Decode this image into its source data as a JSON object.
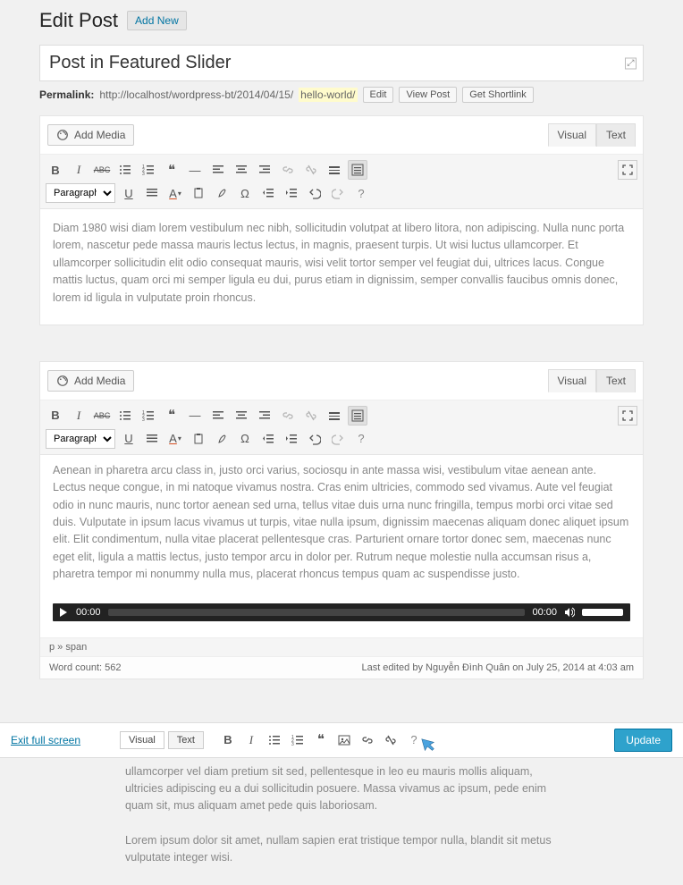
{
  "header": {
    "title": "Edit Post",
    "add_new": "Add New"
  },
  "post": {
    "title": "Post in Featured Slider"
  },
  "permalink": {
    "label": "Permalink:",
    "url_prefix": "http://localhost/wordpress-bt/2014/04/15/",
    "slug": "hello-world/",
    "edit": "Edit",
    "view_post": "View Post",
    "get_shortlink": "Get Shortlink"
  },
  "editor": {
    "add_media": "Add Media",
    "tabs": {
      "visual": "Visual",
      "text": "Text"
    },
    "paragraph": "Paragraph",
    "content1": "Diam 1980 wisi diam lorem vestibulum nec nibh, sollicitudin volutpat at libero litora, non adipiscing. Nulla nunc porta lorem, nascetur pede massa mauris lectus lectus, in magnis, praesent turpis. Ut wisi luctus ullamcorper. Et ullamcorper sollicitudin elit odio consequat mauris, wisi velit tortor semper vel feugiat dui, ultrices lacus. Congue mattis luctus, quam orci mi semper ligula eu dui, purus etiam in dignissim, semper convallis faucibus omnis donec, lorem id ligula in vulputate proin rhoncus."
  },
  "editor2": {
    "add_media": "Add Media",
    "tabs": {
      "visual": "Visual",
      "text": "Text"
    },
    "paragraph": "Paragraph",
    "content": "Aenean in pharetra arcu class in, justo orci varius, sociosqu in ante massa wisi, vestibulum vitae aenean ante. Lectus neque congue, in mi natoque vivamus nostra. Cras enim ultricies, commodo sed vivamus. Aute vel feugiat odio in nunc mauris, nunc tortor aenean sed urna, tellus vitae duis urna nunc fringilla, tempus morbi orci vitae sed duis. Vulputate in ipsum lacus vivamus ut turpis, vitae nulla ipsum, dignissim maecenas aliquam donec aliquet ipsum elit. Elit condimentum, nulla vitae placerat pellentesque cras. Parturient ornare tortor donec sem, maecenas nunc eget elit, ligula a mattis lectus, justo tempor arcu in dolor per. Rutrum neque molestie nulla accumsan risus a, pharetra tempor mi nonummy nulla mus, placerat rhoncus tempus quam ac suspendisse justo.",
    "audio": {
      "current": "00:00",
      "total": "00:00"
    },
    "path": "p » span",
    "wordcount_label": "Word count:",
    "wordcount_value": "562",
    "lastedit": "Last edited by Nguyễn Đình Quân on July 25, 2014 at 4:03 am"
  },
  "dfe": {
    "exit": "Exit full screen",
    "tabs": {
      "visual": "Visual",
      "text": "Text"
    },
    "update": "Update",
    "body1": "ullamcorper vel diam pretium sit sed, pellentesque in leo eu mauris mollis aliquam, ultricies adipiscing eu a dui sollicitudin posuere. Massa vivamus ac ipsum, pede enim quam sit, mus aliquam amet pede quis laboriosam.",
    "body2": "Lorem ipsum dolor sit amet, nullam sapien erat tristique tempor nulla, blandit sit metus vulputate integer wisi."
  }
}
